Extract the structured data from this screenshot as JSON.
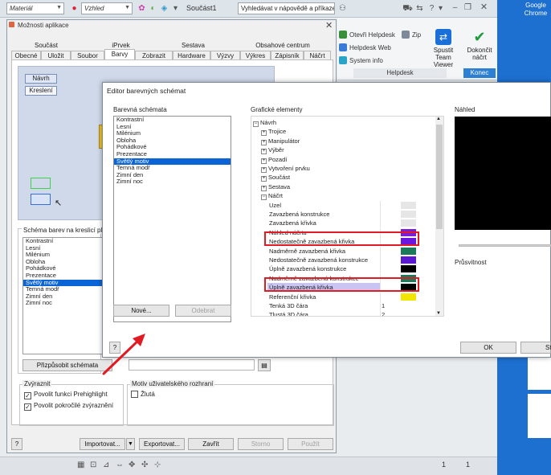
{
  "appbar": {
    "material_combo": "Materiál",
    "appearance_combo": "Vzhled",
    "doc_title": "Součást1",
    "search_placeholder": "Vyhledávat v nápovědě a příkaze"
  },
  "ribbon": {
    "open_helpdesk": "Otevři Helpdesk",
    "zip": "Zip",
    "helpdesk_web": "Helpdesk Web",
    "system_info": "System info",
    "team_viewer_1": "Spustit",
    "team_viewer_2": "Team Viewer",
    "finish_1": "Dokončit",
    "finish_2": "náčrt",
    "group_helpdesk": "Helpdesk",
    "group_konec": "Konec"
  },
  "desktop": {
    "chrome_label": "Google Chrome"
  },
  "options": {
    "title": "Možnosti aplikace",
    "tabs_top": [
      "Součást",
      "iPrvek",
      "Sestava",
      "Obsahové centrum"
    ],
    "tabs_bottom": [
      "Obecné",
      "Uložit",
      "Soubor",
      "Barvy",
      "Zobrazit",
      "Hardware",
      "Výzvy",
      "Výkres",
      "Zápisník",
      "Náčrt"
    ],
    "preview_buttons": {
      "design": "Návrh",
      "drawing": "Kreslení"
    },
    "schema_group_label": "Schéma barev na kreslicí ploše",
    "schemas": [
      "Kontrastní",
      "Lesní",
      "Milénium",
      "Obloha",
      "Pohádkové",
      "Prezentace",
      "Světlý motiv",
      "Temná modř",
      "Zimní den",
      "Zimní noc"
    ],
    "selected_schema": "Světlý motiv",
    "customize_button": "Přizpůsobit schémata",
    "highlight_group": "Zvýraznit",
    "highlight_prehighlight": "Povolit funkci Prehighlight",
    "highlight_advanced": "Povolit pokročilé zvýraznění",
    "ui_theme_group": "Motiv uživatelského rozhraní",
    "ui_theme_yellow": "Žlutá",
    "import_button": "Importovat...",
    "export_button": "Exportovat...",
    "close_button": "Zavřít",
    "cancel_button": "Storno",
    "apply_button": "Použít"
  },
  "editor": {
    "title": "Editor barevných schémat",
    "schemes_label": "Barevná schémata",
    "schemes": [
      "Kontrastní",
      "Lesní",
      "Milénium",
      "Obloha",
      "Pohádkové",
      "Prezentace",
      "Světlý motiv",
      "Temná modř",
      "Zimní den",
      "Zimní noc"
    ],
    "selected_scheme": "Světlý motiv",
    "new_button": "Nové...",
    "remove_button": "Odebrat",
    "graphic_label": "Grafické elementy",
    "preview_label": "Náhled",
    "transparency_label": "Průsvitnost",
    "ok_button": "OK",
    "cancel_button": "Sto",
    "tree": [
      {
        "label": "Návrh",
        "level": 0,
        "expander": "−"
      },
      {
        "label": "Trojice",
        "level": 1,
        "expander": "+"
      },
      {
        "label": "Manipulátor",
        "level": 1,
        "expander": "+"
      },
      {
        "label": "Výběr",
        "level": 1,
        "expander": "+"
      },
      {
        "label": "Pozadí",
        "level": 1,
        "expander": "+"
      },
      {
        "label": "Vytvoření prvku",
        "level": 1,
        "expander": "+"
      },
      {
        "label": "Součást",
        "level": 1,
        "expander": "+"
      },
      {
        "label": "Sestava",
        "level": 1,
        "expander": "+"
      },
      {
        "label": "Náčrt",
        "level": 1,
        "expander": "−"
      },
      {
        "label": "Uzel",
        "level": 2,
        "color": "#e6e6e6"
      },
      {
        "label": "Zavazbená konstrukce",
        "level": 2,
        "color": "#e6e6e6"
      },
      {
        "label": "Zavazbená křivka",
        "level": 2,
        "color": "#e6e6e6"
      },
      {
        "label": "Náhled náčrtu",
        "level": 2,
        "color": "#7b1fd6"
      },
      {
        "label": "Nedostatečně zavazbená křivka",
        "level": 2,
        "color": "#6a17e0"
      },
      {
        "label": "Nadměrně zavazbená křivka",
        "level": 2,
        "color": "#1a7a5a"
      },
      {
        "label": "Nedostatečně zavazbená konstrukce",
        "level": 2,
        "color": "#5a1ad0"
      },
      {
        "label": "Úplně zavazbená konstrukce",
        "level": 2,
        "color": "#000000"
      },
      {
        "label": "Nadměrně zavazbená konstrukce",
        "level": 2,
        "color": "#1a7a5a"
      },
      {
        "label": "Úplně zavazbená křivka",
        "level": 2,
        "color": "#000000",
        "selected": true
      },
      {
        "label": "Referenční křivka",
        "level": 2,
        "color": "#f2e600"
      },
      {
        "label": "Tenká 3D čára",
        "level": 2,
        "value": "1"
      },
      {
        "label": "Tlustá 3D čára",
        "level": 2,
        "value": "2"
      }
    ]
  }
}
